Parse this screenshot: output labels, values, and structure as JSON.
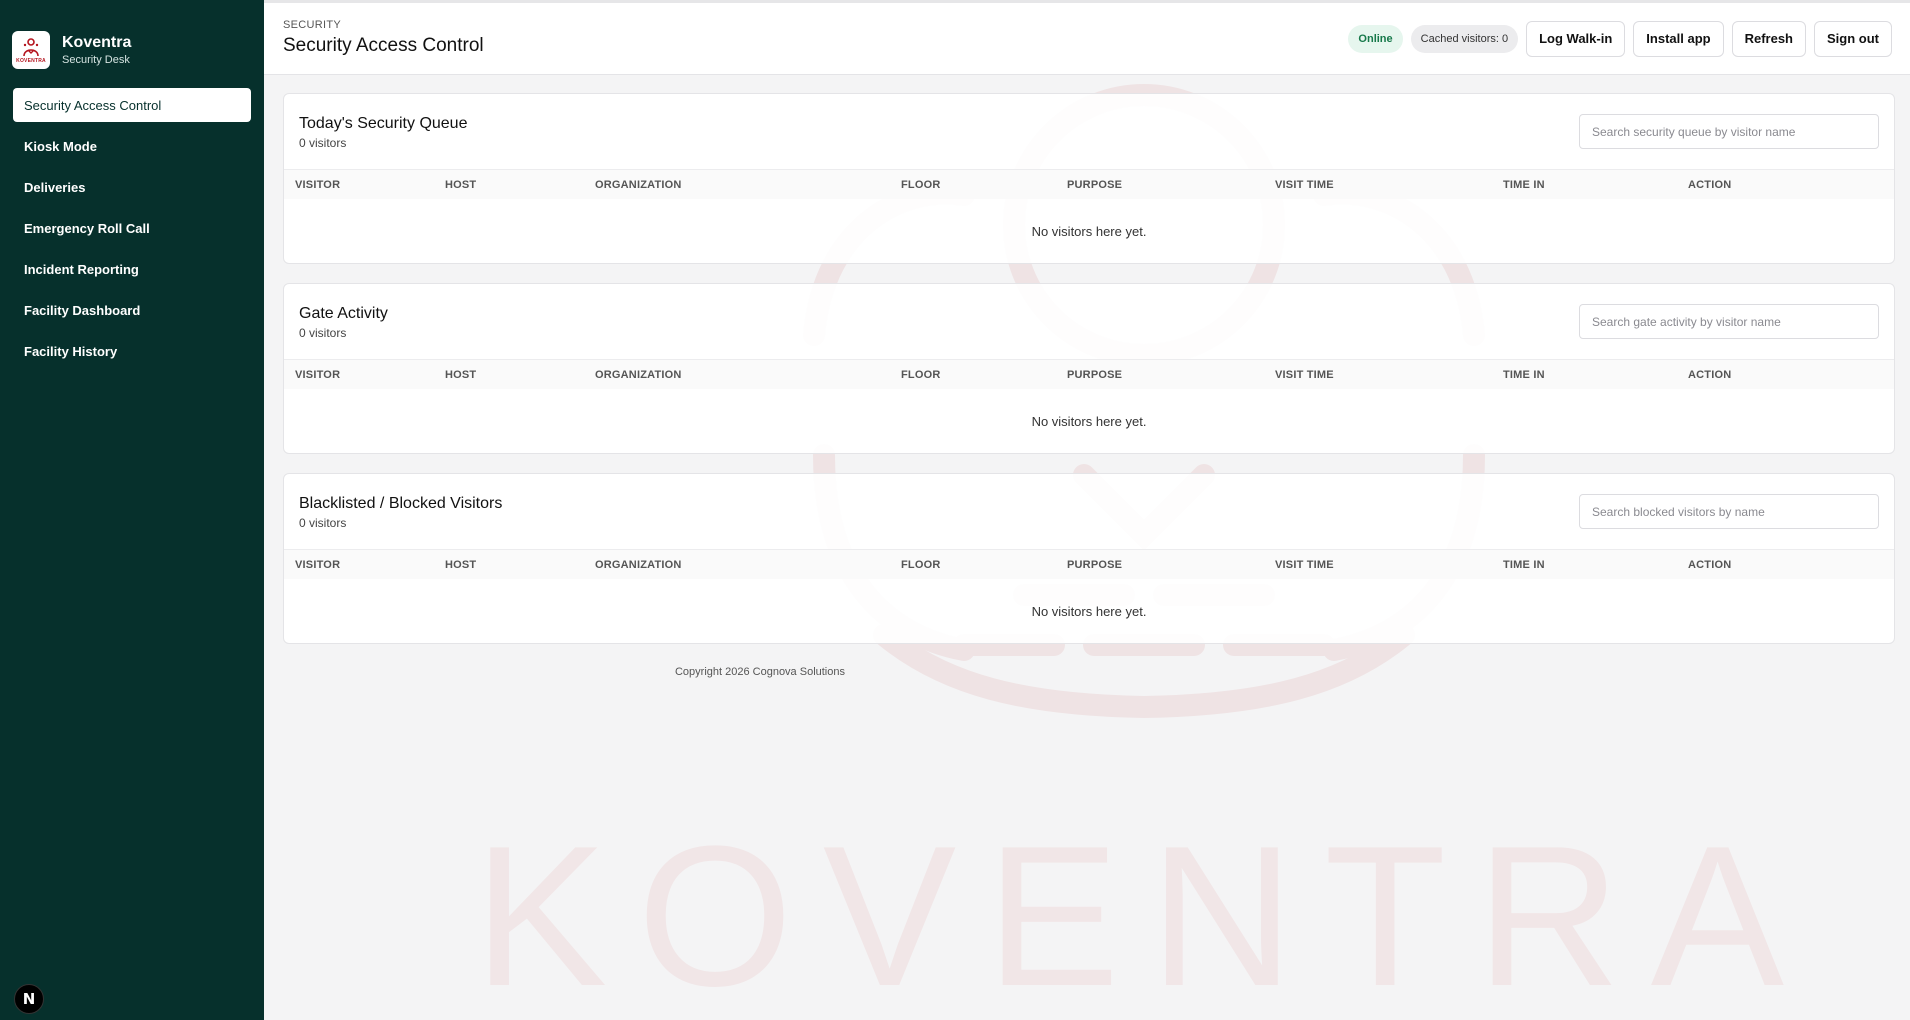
{
  "brand": {
    "name": "Koventra",
    "subtitle": "Security Desk",
    "logo_text": "KOVENTRA"
  },
  "nav": {
    "items": [
      {
        "label": "Security Access Control",
        "active": true
      },
      {
        "label": "Kiosk Mode"
      },
      {
        "label": "Deliveries"
      },
      {
        "label": "Emergency Roll Call"
      },
      {
        "label": "Incident Reporting"
      },
      {
        "label": "Facility Dashboard"
      },
      {
        "label": "Facility History"
      }
    ]
  },
  "header": {
    "breadcrumb": "SECURITY",
    "title": "Security Access Control",
    "status": "Online",
    "cached": "Cached visitors: 0",
    "actions": {
      "log_walkin": "Log Walk-in",
      "install": "Install app",
      "refresh": "Refresh",
      "signout": "Sign out"
    }
  },
  "table_columns": [
    "VISITOR",
    "HOST",
    "ORGANIZATION",
    "FLOOR",
    "PURPOSE",
    "VISIT TIME",
    "TIME IN",
    "ACTION"
  ],
  "sections": [
    {
      "title": "Today's Security Queue",
      "count": "0 visitors",
      "search_placeholder": "Search security queue by visitor name",
      "empty": "No visitors here yet."
    },
    {
      "title": "Gate Activity",
      "count": "0 visitors",
      "search_placeholder": "Search gate activity by visitor name",
      "empty": "No visitors here yet."
    },
    {
      "title": "Blacklisted / Blocked Visitors",
      "count": "0 visitors",
      "search_placeholder": "Search blocked visitors by name",
      "empty": "No visitors here yet."
    }
  ],
  "footer": {
    "copyright": "Copyright 2026 Cognova Solutions"
  },
  "watermark": {
    "text": "KOVENTRA"
  },
  "colors": {
    "sidebar": "#06302c",
    "online_bg": "#e6f6ee",
    "online_text": "#16794a",
    "brand_red": "#b4141e"
  }
}
